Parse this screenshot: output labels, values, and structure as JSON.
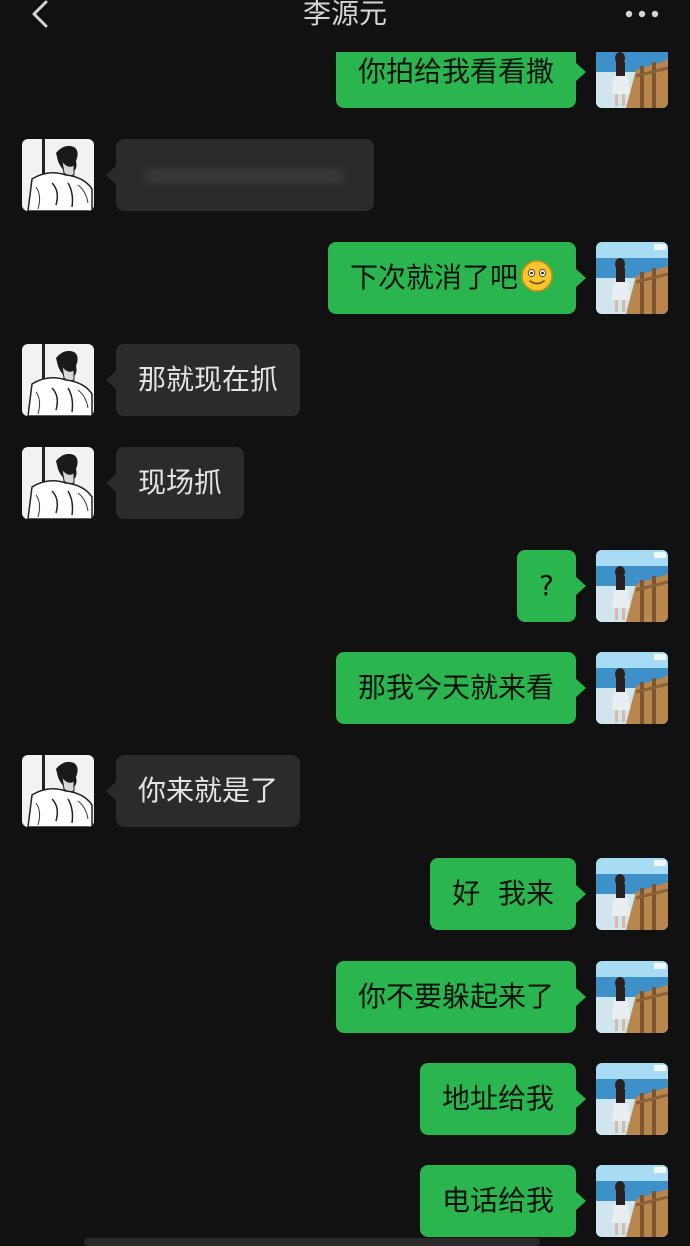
{
  "header": {
    "title": "李源元",
    "back_icon": "chevron-left-icon",
    "more_icon": "more-horizontal-icon"
  },
  "messages": [
    {
      "from": "me",
      "text": "你拍给我看看撒"
    },
    {
      "from": "them",
      "text": ""
    },
    {
      "from": "me",
      "text": "下次就消了吧",
      "emoji": "smiling-face-emoji"
    },
    {
      "from": "them",
      "text": "那就现在抓"
    },
    {
      "from": "them",
      "text": "现场抓"
    },
    {
      "from": "me",
      "text": "?"
    },
    {
      "from": "me",
      "text": "那我今天就来看"
    },
    {
      "from": "them",
      "text": "你来就是了"
    },
    {
      "from": "me",
      "text": "好  我来"
    },
    {
      "from": "me",
      "text": "你不要躲起来了"
    },
    {
      "from": "me",
      "text": "地址给我"
    },
    {
      "from": "me",
      "text": "电话给我"
    }
  ],
  "colors": {
    "background": "#111111",
    "my_bubble": "#2bb54f",
    "their_bubble": "#2b2b2b"
  }
}
